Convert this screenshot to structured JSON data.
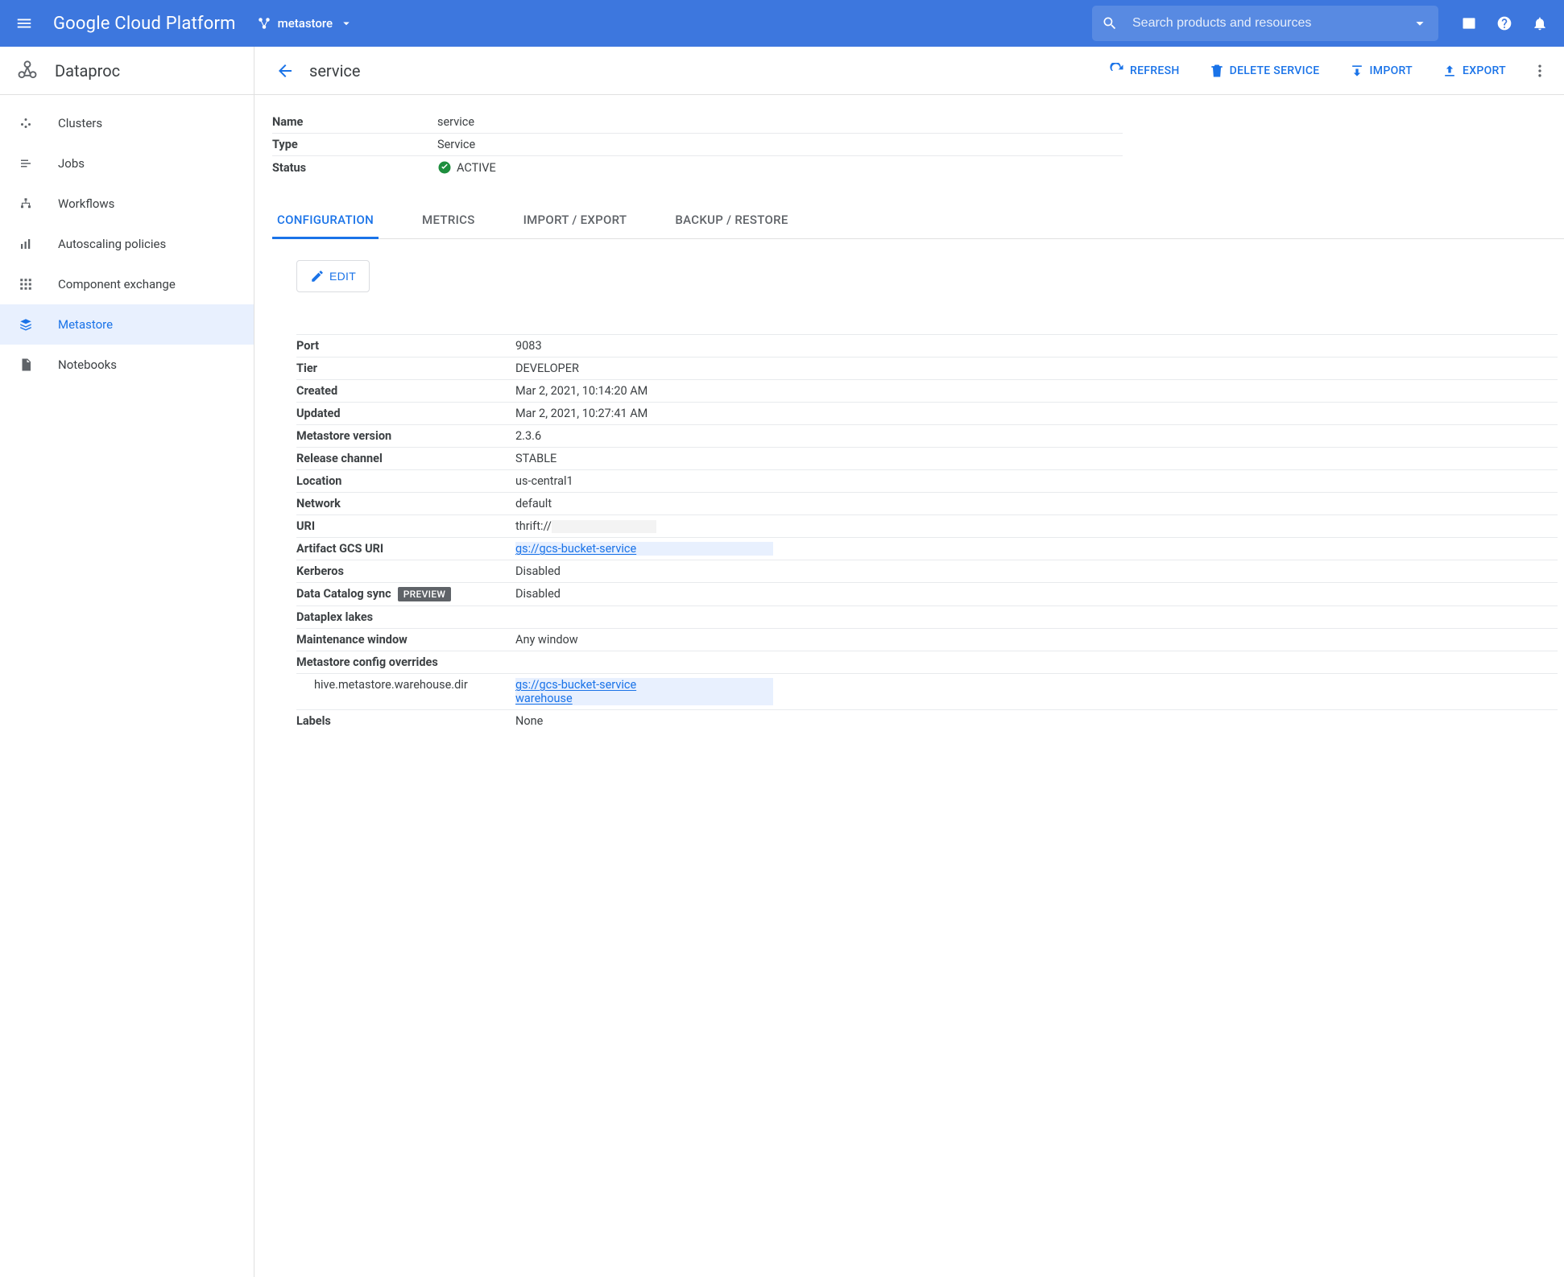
{
  "header": {
    "brand": "Google Cloud Platform",
    "project": "metastore",
    "search_placeholder": "Search products and resources"
  },
  "sidebar": {
    "title": "Dataproc",
    "items": [
      {
        "label": "Clusters"
      },
      {
        "label": "Jobs"
      },
      {
        "label": "Workflows"
      },
      {
        "label": "Autoscaling policies"
      },
      {
        "label": "Component exchange"
      },
      {
        "label": "Metastore"
      },
      {
        "label": "Notebooks"
      }
    ]
  },
  "page": {
    "title": "service",
    "actions": {
      "refresh": "REFRESH",
      "delete": "DELETE SERVICE",
      "import": "IMPORT",
      "export": "EXPORT"
    },
    "summary": {
      "name_label": "Name",
      "name_value": "service",
      "type_label": "Type",
      "type_value": "Service",
      "status_label": "Status",
      "status_value": "ACTIVE"
    },
    "tabs": [
      {
        "label": "CONFIGURATION"
      },
      {
        "label": "METRICS"
      },
      {
        "label": "IMPORT / EXPORT"
      },
      {
        "label": "BACKUP / RESTORE"
      }
    ],
    "edit_label": "EDIT",
    "preview_badge": "PREVIEW",
    "details": {
      "port_label": "Port",
      "port_value": "9083",
      "tier_label": "Tier",
      "tier_value": "DEVELOPER",
      "created_label": "Created",
      "created_value": "Mar 2, 2021, 10:14:20 AM",
      "updated_label": "Updated",
      "updated_value": "Mar 2, 2021, 10:27:41 AM",
      "metaver_label": "Metastore version",
      "metaver_value": "2.3.6",
      "channel_label": "Release channel",
      "channel_value": "STABLE",
      "location_label": "Location",
      "location_value": "us-central1",
      "network_label": "Network",
      "network_value": "default",
      "uri_label": "URI",
      "uri_value": "thrift://",
      "gcs_label": "Artifact GCS URI",
      "gcs_value": "gs://gcs-bucket-service",
      "kerberos_label": "Kerberos",
      "kerberos_value": "Disabled",
      "dcs_label": "Data Catalog sync",
      "dcs_value": "Disabled",
      "dataplex_label": "Dataplex lakes",
      "maint_label": "Maintenance window",
      "maint_value": "Any window",
      "overrides_label": "Metastore config overrides",
      "override_key": "hive.metastore.warehouse.dir",
      "override_val1": "gs://gcs-bucket-service",
      "override_val2": "warehouse",
      "labels_label": "Labels",
      "labels_value": "None"
    }
  }
}
